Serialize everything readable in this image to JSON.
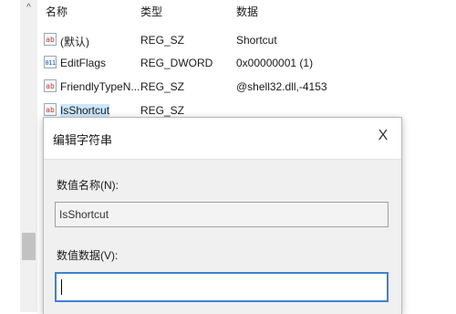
{
  "header": {
    "name": "名称",
    "type": "类型",
    "data": "数据"
  },
  "rows": [
    {
      "icon": "string-value-icon",
      "glyph": "ab",
      "name": "(默认)",
      "type": "REG_SZ",
      "data": "Shortcut"
    },
    {
      "icon": "binary-value-icon",
      "glyph": "011",
      "name": "EditFlags",
      "type": "REG_DWORD",
      "data": "0x00000001 (1)"
    },
    {
      "icon": "string-value-icon",
      "glyph": "ab",
      "name": "FriendlyTypeN...",
      "type": "REG_SZ",
      "data": "@shell32.dll,-4153"
    },
    {
      "icon": "string-value-icon",
      "glyph": "ab",
      "name": "IsShortcut",
      "type": "REG_SZ",
      "data": ""
    }
  ],
  "scrollbar": {
    "up_glyph": "^"
  },
  "dialog": {
    "title": "编辑字符串",
    "close_glyph": "X",
    "value_name_label": "数值名称(N):",
    "value_name": "IsShortcut",
    "value_data_label": "数值数据(V):",
    "value_data": ""
  }
}
